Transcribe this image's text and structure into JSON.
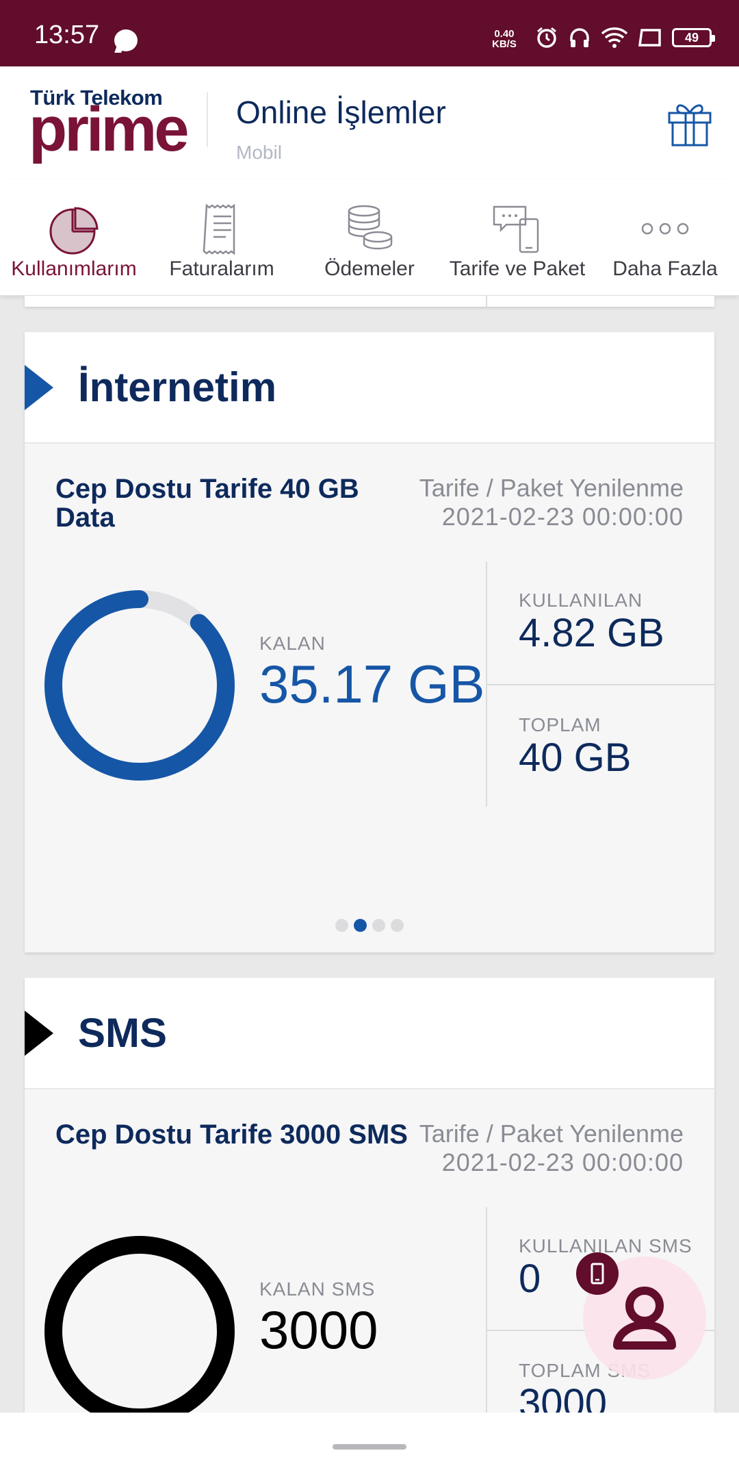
{
  "status_bar": {
    "time": "13:57",
    "net_speed_value": "0.40",
    "net_speed_unit": "KB/S",
    "battery": "49",
    "icons": [
      "message-icon",
      "alarm-icon",
      "headphones-icon",
      "wifi-icon",
      "screen-icon",
      "battery-icon"
    ]
  },
  "header": {
    "brand": "Türk Telekom",
    "logo_word": "prime",
    "title": "Online İşlemler",
    "subtitle": "Mobil",
    "gift_icon": "gift-icon"
  },
  "nav": {
    "items": [
      {
        "label": "Kullanımlarım",
        "icon": "pie-chart-icon",
        "active": true
      },
      {
        "label": "Faturalarım",
        "icon": "receipt-icon",
        "active": false
      },
      {
        "label": "Ödemeler",
        "icon": "coins-icon",
        "active": false
      },
      {
        "label": "Tarife ve Paket",
        "icon": "chat-phone-icon",
        "active": false
      },
      {
        "label": "Daha Fazla",
        "icon": "more-icon",
        "active": false
      }
    ]
  },
  "internet_card": {
    "title": "İnternetim",
    "package_name": "Cep Dostu Tarife 40 GB Data",
    "renewal_label": "Tarife / Paket Yenilenme",
    "renewal_date": "2021-02-23 00:00:00",
    "remaining_label": "KALAN",
    "remaining_value": "35.17 GB",
    "used_label": "KULLANILAN",
    "used_value": "4.82 GB",
    "total_label": "TOPLAM",
    "total_value": "40 GB",
    "remaining_fraction": 0.879,
    "pager_count": 4,
    "pager_active": 1,
    "accent_color": "#1656a6"
  },
  "sms_card": {
    "title": "SMS",
    "package_name": "Cep Dostu Tarife 3000 SMS",
    "renewal_label": "Tarife / Paket Yenilenme",
    "renewal_date": "2021-02-23 00:00:00",
    "remaining_label": "KALAN SMS",
    "remaining_value": "3000",
    "used_label": "KULLANILAN SMS",
    "used_value": "0",
    "total_label": "TOPLAM SMS",
    "total_value": "3000",
    "remaining_fraction": 1.0
  },
  "floating": {
    "assistant_icon": "person-icon",
    "badge_icon": "phone-icon"
  },
  "colors": {
    "brand": "#610d2b",
    "navy": "#0e2a5c",
    "blue": "#1656a6"
  }
}
